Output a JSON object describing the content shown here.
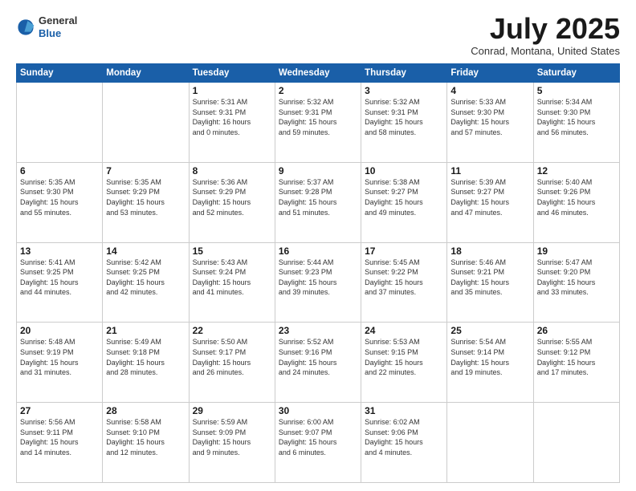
{
  "header": {
    "logo": {
      "general": "General",
      "blue": "Blue"
    },
    "title": "July 2025",
    "location": "Conrad, Montana, United States"
  },
  "weekdays": [
    "Sunday",
    "Monday",
    "Tuesday",
    "Wednesday",
    "Thursday",
    "Friday",
    "Saturday"
  ],
  "weeks": [
    [
      {
        "day": "",
        "info": ""
      },
      {
        "day": "",
        "info": ""
      },
      {
        "day": "1",
        "info": "Sunrise: 5:31 AM\nSunset: 9:31 PM\nDaylight: 16 hours\nand 0 minutes."
      },
      {
        "day": "2",
        "info": "Sunrise: 5:32 AM\nSunset: 9:31 PM\nDaylight: 15 hours\nand 59 minutes."
      },
      {
        "day": "3",
        "info": "Sunrise: 5:32 AM\nSunset: 9:31 PM\nDaylight: 15 hours\nand 58 minutes."
      },
      {
        "day": "4",
        "info": "Sunrise: 5:33 AM\nSunset: 9:30 PM\nDaylight: 15 hours\nand 57 minutes."
      },
      {
        "day": "5",
        "info": "Sunrise: 5:34 AM\nSunset: 9:30 PM\nDaylight: 15 hours\nand 56 minutes."
      }
    ],
    [
      {
        "day": "6",
        "info": "Sunrise: 5:35 AM\nSunset: 9:30 PM\nDaylight: 15 hours\nand 55 minutes."
      },
      {
        "day": "7",
        "info": "Sunrise: 5:35 AM\nSunset: 9:29 PM\nDaylight: 15 hours\nand 53 minutes."
      },
      {
        "day": "8",
        "info": "Sunrise: 5:36 AM\nSunset: 9:29 PM\nDaylight: 15 hours\nand 52 minutes."
      },
      {
        "day": "9",
        "info": "Sunrise: 5:37 AM\nSunset: 9:28 PM\nDaylight: 15 hours\nand 51 minutes."
      },
      {
        "day": "10",
        "info": "Sunrise: 5:38 AM\nSunset: 9:27 PM\nDaylight: 15 hours\nand 49 minutes."
      },
      {
        "day": "11",
        "info": "Sunrise: 5:39 AM\nSunset: 9:27 PM\nDaylight: 15 hours\nand 47 minutes."
      },
      {
        "day": "12",
        "info": "Sunrise: 5:40 AM\nSunset: 9:26 PM\nDaylight: 15 hours\nand 46 minutes."
      }
    ],
    [
      {
        "day": "13",
        "info": "Sunrise: 5:41 AM\nSunset: 9:25 PM\nDaylight: 15 hours\nand 44 minutes."
      },
      {
        "day": "14",
        "info": "Sunrise: 5:42 AM\nSunset: 9:25 PM\nDaylight: 15 hours\nand 42 minutes."
      },
      {
        "day": "15",
        "info": "Sunrise: 5:43 AM\nSunset: 9:24 PM\nDaylight: 15 hours\nand 41 minutes."
      },
      {
        "day": "16",
        "info": "Sunrise: 5:44 AM\nSunset: 9:23 PM\nDaylight: 15 hours\nand 39 minutes."
      },
      {
        "day": "17",
        "info": "Sunrise: 5:45 AM\nSunset: 9:22 PM\nDaylight: 15 hours\nand 37 minutes."
      },
      {
        "day": "18",
        "info": "Sunrise: 5:46 AM\nSunset: 9:21 PM\nDaylight: 15 hours\nand 35 minutes."
      },
      {
        "day": "19",
        "info": "Sunrise: 5:47 AM\nSunset: 9:20 PM\nDaylight: 15 hours\nand 33 minutes."
      }
    ],
    [
      {
        "day": "20",
        "info": "Sunrise: 5:48 AM\nSunset: 9:19 PM\nDaylight: 15 hours\nand 31 minutes."
      },
      {
        "day": "21",
        "info": "Sunrise: 5:49 AM\nSunset: 9:18 PM\nDaylight: 15 hours\nand 28 minutes."
      },
      {
        "day": "22",
        "info": "Sunrise: 5:50 AM\nSunset: 9:17 PM\nDaylight: 15 hours\nand 26 minutes."
      },
      {
        "day": "23",
        "info": "Sunrise: 5:52 AM\nSunset: 9:16 PM\nDaylight: 15 hours\nand 24 minutes."
      },
      {
        "day": "24",
        "info": "Sunrise: 5:53 AM\nSunset: 9:15 PM\nDaylight: 15 hours\nand 22 minutes."
      },
      {
        "day": "25",
        "info": "Sunrise: 5:54 AM\nSunset: 9:14 PM\nDaylight: 15 hours\nand 19 minutes."
      },
      {
        "day": "26",
        "info": "Sunrise: 5:55 AM\nSunset: 9:12 PM\nDaylight: 15 hours\nand 17 minutes."
      }
    ],
    [
      {
        "day": "27",
        "info": "Sunrise: 5:56 AM\nSunset: 9:11 PM\nDaylight: 15 hours\nand 14 minutes."
      },
      {
        "day": "28",
        "info": "Sunrise: 5:58 AM\nSunset: 9:10 PM\nDaylight: 15 hours\nand 12 minutes."
      },
      {
        "day": "29",
        "info": "Sunrise: 5:59 AM\nSunset: 9:09 PM\nDaylight: 15 hours\nand 9 minutes."
      },
      {
        "day": "30",
        "info": "Sunrise: 6:00 AM\nSunset: 9:07 PM\nDaylight: 15 hours\nand 6 minutes."
      },
      {
        "day": "31",
        "info": "Sunrise: 6:02 AM\nSunset: 9:06 PM\nDaylight: 15 hours\nand 4 minutes."
      },
      {
        "day": "",
        "info": ""
      },
      {
        "day": "",
        "info": ""
      }
    ]
  ]
}
